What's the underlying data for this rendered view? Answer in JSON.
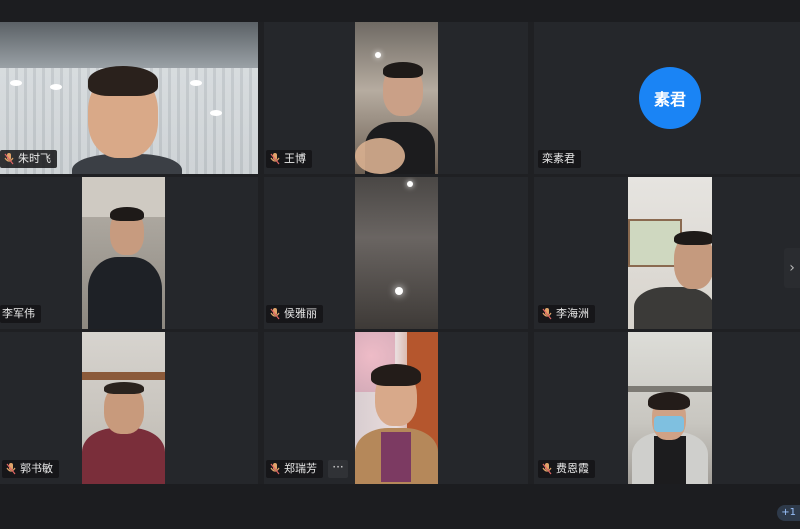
{
  "participants": [
    {
      "name": "朱时飞"
    },
    {
      "name": "王博"
    },
    {
      "name": "栾素君",
      "avatar_text": "素君"
    },
    {
      "name": "李军伟"
    },
    {
      "name": "侯雅丽"
    },
    {
      "name": "李海洲"
    },
    {
      "name": "郭书敏"
    },
    {
      "name": "郑瑞芳"
    },
    {
      "name": "费恩霞"
    }
  ],
  "controls": {
    "more_label": "···",
    "next_label": "›",
    "page_indicator": "+1"
  },
  "colors": {
    "tile_bg": "#25272b",
    "avatar": "#1a84f5",
    "mic_icon": "#e0a46a"
  }
}
